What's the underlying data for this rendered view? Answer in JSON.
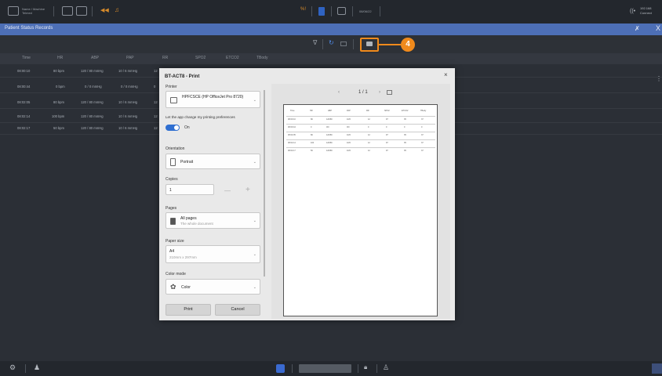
{
  "topbar": {
    "device_name_line1": "Name / Machine",
    "device_name_line2": "Telmed",
    "center_value": "08/06/22",
    "signal": "((•",
    "ip_line1": "192.168",
    "ip_line2": "Connect"
  },
  "titlebar": {
    "title": "Patient Status Records",
    "pin": "✗",
    "close": "X"
  },
  "toolbar": {
    "filter": "∇",
    "refresh": "↻",
    "print_callout": "4",
    "more": "⋮"
  },
  "table": {
    "columns": [
      "Time",
      "HR",
      "ABP",
      "PAP",
      "RR",
      "SPO2",
      "ETCO2",
      "TBody"
    ],
    "rows": [
      {
        "time": "08:00:10",
        "hr": "80 bpm",
        "abp": "120 / 80 mmHg",
        "pap": "10 / 6 mmHg",
        "rr": "12"
      },
      {
        "time": "08:00:44",
        "hr": "0 bpm",
        "abp": "0 / 0 mmHg",
        "pap": "0 / 0 mmHg",
        "rr": "0"
      },
      {
        "time": "08:02:05",
        "hr": "80 bpm",
        "abp": "120 / 80 mmHg",
        "pap": "10 / 6 mmHg",
        "rr": "12"
      },
      {
        "time": "08:02:14",
        "hr": "100 bpm",
        "abp": "120 / 80 mmHg",
        "pap": "10 / 6 mmHg",
        "rr": "12"
      },
      {
        "time": "08:02:17",
        "hr": "50 bpm",
        "abp": "120 / 80 mmHg",
        "pap": "10 / 6 mmHg",
        "rr": "12"
      }
    ]
  },
  "dialog": {
    "title": "BT-ACT8 - Print",
    "close": "×",
    "printer_label": "Printer",
    "printer_value": "HPFCSCE (HP OfficeJet Pro 8720)",
    "pref_label": "Let the app change my printing preferences",
    "pref_state": "On",
    "orientation_label": "Orientation",
    "orientation_value": "Portrait",
    "copies_label": "Copies",
    "copies_value": "1",
    "pages_label": "Pages",
    "pages_value": "All pages",
    "pages_sub": "The whole document",
    "paper_label": "Paper size",
    "paper_value": "A4",
    "paper_sub": "210mm x 297mm",
    "color_label": "Color mode",
    "color_value": "Color",
    "print_button": "Print",
    "cancel_button": "Cancel",
    "page_counter": "1 / 1"
  },
  "preview": {
    "columns": [
      "Time",
      "HR",
      "ABP",
      "PAP",
      "RR",
      "SPO2",
      "ETCO2",
      "TBody"
    ],
    "rows": [
      [
        "08:00:10",
        "80",
        "120/80",
        "10/6",
        "12",
        "97",
        "35",
        "37"
      ],
      [
        "08:00:44",
        "0",
        "0/0",
        "0/0",
        "0",
        "0",
        "0",
        "0"
      ],
      [
        "08:02:05",
        "80",
        "120/80",
        "10/6",
        "12",
        "97",
        "35",
        "37"
      ],
      [
        "08:02:14",
        "100",
        "120/80",
        "10/6",
        "12",
        "97",
        "35",
        "37"
      ],
      [
        "08:02:17",
        "50",
        "120/80",
        "10/6",
        "12",
        "97",
        "35",
        "37"
      ]
    ]
  },
  "bottombar": {
    "settings": "⚙",
    "user": "♟",
    "lock": "🔒"
  }
}
